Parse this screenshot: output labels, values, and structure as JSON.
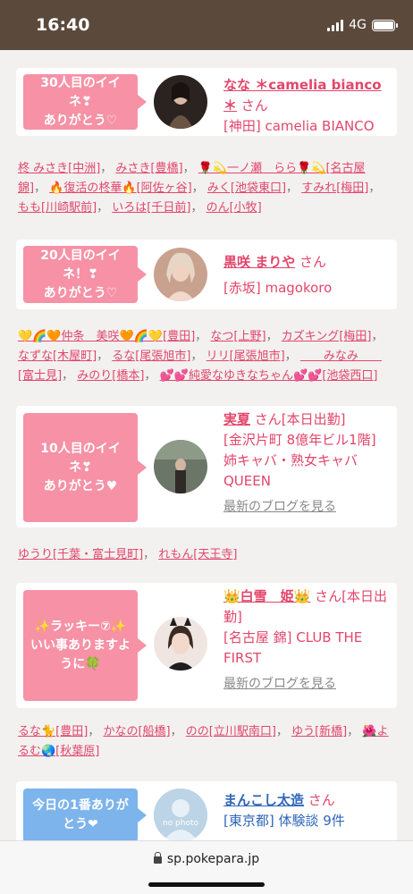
{
  "status": {
    "time": "16:40",
    "network": "4G"
  },
  "cards": [
    {
      "bubble": [
        "30人目のイイ",
        "ネ❣",
        "ありがとう♡"
      ],
      "name": "なな ＊camelia bianco ＊",
      "san": "さん",
      "shop": "[神田] camelia BIANCO",
      "blog": ""
    },
    {
      "bubble": [
        "20人目のイイ",
        "ネ！❣",
        "ありがとう♡"
      ],
      "name": "黒咲 まりや",
      "san": "さん",
      "shop": "[赤坂] magokoro",
      "blog": ""
    },
    {
      "bubble": [
        "10人目のイイ",
        "ネ❣",
        "ありがとう♥"
      ],
      "name": "実夏",
      "san": "さん[本日出勤]",
      "shop": "[金沢片町 8億年ビル1階] 姉キャバ・熟女キャバQUEEN",
      "blog": "最新のブログを見る"
    },
    {
      "bubble": [
        "✨ラッキー⑦✨",
        "いい事ありますよ",
        "うに🍀"
      ],
      "name": "👑白雪　姫👑",
      "san": "さん[本日出勤]",
      "shop": "[名古屋 錦] CLUB THE FIRST",
      "blog": "最新のブログを見る"
    },
    {
      "bubble": [
        "今日の1番ありが",
        "とう❤"
      ],
      "name": "まんこし太造",
      "san": "さん",
      "shop": "[東京都] 体験談 9件",
      "blog": "",
      "avatar_text": "no photo"
    }
  ],
  "link_groups": [
    [
      "柊 みさき[中洲]",
      "みさき[豊橋]",
      "🌹💫一ノ瀬　らら🌹💫[名古屋 錦]",
      "🔥復活の柊華🔥[阿佐ヶ谷]",
      "みく[池袋東口]",
      "すみれ[梅田]",
      "もも[川崎駅前]",
      "いろは[千日前]",
      "のん[小牧]"
    ],
    [
      "💛🌈🧡仲条　美咲🧡🌈💛[豊田]",
      "なつ[上野]",
      "カズキング[梅田]",
      "なずな[木屋町]",
      "るな[尾張旭市]",
      "リリ[尾張旭市]",
      "＿＿みなみ＿＿[富士見]",
      "みのり[橋本]",
      "💕💕純愛なゆきなちゃん💕💕[池袋西口]"
    ],
    [
      "ゆうり[千葉・富士見町]",
      "れもん[天王寺]"
    ],
    [
      "るな🐈[豊田]",
      "かなの[船橋]",
      "のの[立川駅南口]",
      "ゆう[新橋]",
      "🌺よるむ🌏[秋葉原]"
    ]
  ],
  "browser": {
    "url": "sp.pokepara.jp"
  }
}
